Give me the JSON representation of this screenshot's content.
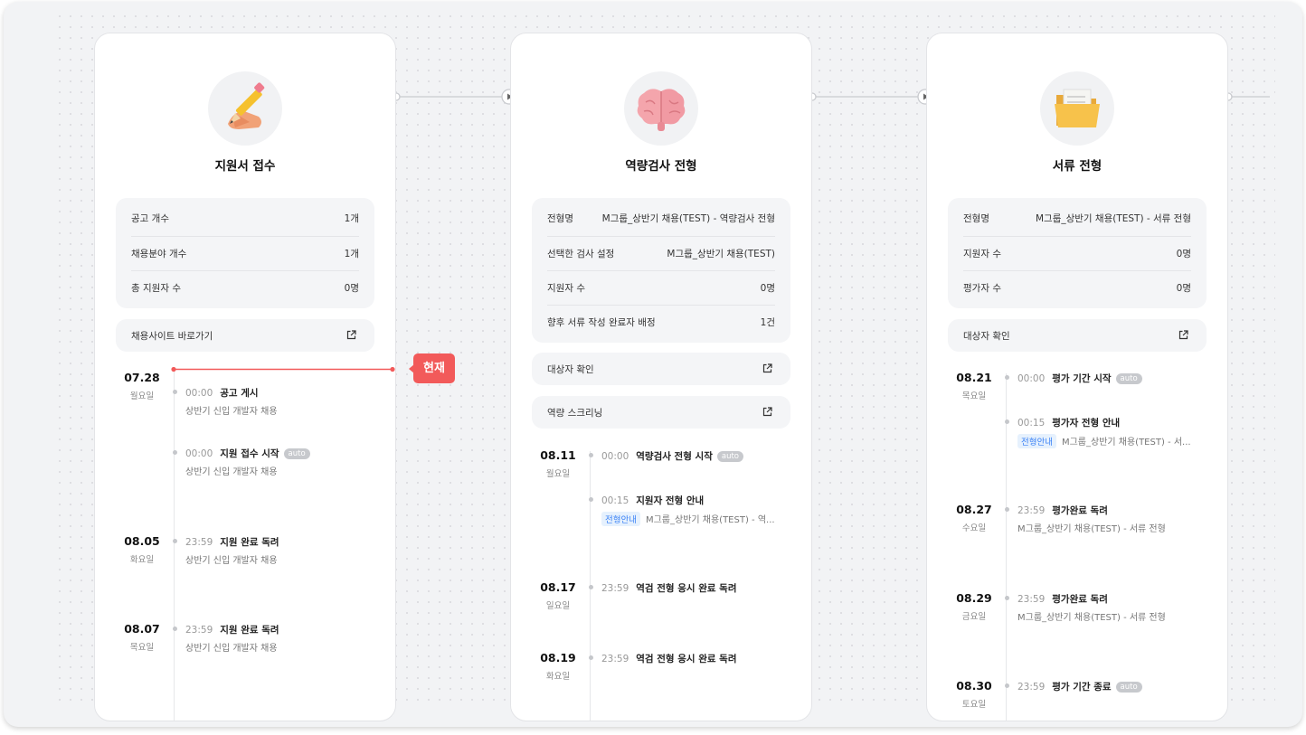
{
  "now_label": "현재",
  "stages": [
    {
      "title": "지원서 접수",
      "emoji_icon": "pencil-hand-icon",
      "info": [
        {
          "label": "공고 개수",
          "value": "1개"
        },
        {
          "label": "채용분야 개수",
          "value": "1개"
        },
        {
          "label": "총 지원자 수",
          "value": "0명"
        }
      ],
      "links": [
        "채용사이트 바로가기"
      ],
      "timeline": [
        {
          "date": "07.28",
          "weekday": "월요일",
          "events": [
            {
              "time": "00:00",
              "title": "공고 게시",
              "sub": "상반기 신입 개발자 채용"
            },
            {
              "time": "00:00",
              "title": "지원 접수 시작",
              "badge": "auto",
              "sub": "상반기 신입 개발자 채용"
            }
          ]
        },
        {
          "date": "08.05",
          "weekday": "화요일",
          "events": [
            {
              "time": "23:59",
              "title": "지원 완료 독려",
              "sub": "상반기 신입 개발자 채용"
            }
          ]
        },
        {
          "date": "08.07",
          "weekday": "목요일",
          "events": [
            {
              "time": "23:59",
              "title": "지원 완료 독려",
              "sub": "상반기 신입 개발자 채용"
            }
          ]
        }
      ]
    },
    {
      "title": "역량검사 전형",
      "emoji_icon": "brain-icon",
      "info": [
        {
          "label": "전형명",
          "value": "M그룹_상반기 채용(TEST) - 역량검사 전형"
        },
        {
          "label": "선택한 검사 설정",
          "value": "M그룹_상반기 채용(TEST)"
        },
        {
          "label": "지원자 수",
          "value": "0명"
        },
        {
          "label": "향후 서류 작성 완료자 배정",
          "value": "1건"
        }
      ],
      "links": [
        "대상자 확인",
        "역량 스크리닝"
      ],
      "timeline": [
        {
          "date": "08.11",
          "weekday": "월요일",
          "events": [
            {
              "time": "00:00",
              "title": "역량검사 전형 시작",
              "badge": "auto"
            },
            {
              "time": "00:15",
              "title": "지원자 전형 안내",
              "tag": "전형안내",
              "sub": "M그룹_상반기 채용(TEST) - 역..."
            }
          ]
        },
        {
          "date": "08.17",
          "weekday": "일요일",
          "events": [
            {
              "time": "23:59",
              "title": "역검 전형 응시 완료 독려"
            }
          ]
        },
        {
          "date": "08.19",
          "weekday": "화요일",
          "events": [
            {
              "time": "23:59",
              "title": "역검 전형 응시 완료 독려"
            }
          ]
        }
      ]
    },
    {
      "title": "서류 전형",
      "emoji_icon": "folder-icon",
      "info": [
        {
          "label": "전형명",
          "value": "M그룹_상반기 채용(TEST) - 서류 전형"
        },
        {
          "label": "지원자 수",
          "value": "0명"
        },
        {
          "label": "평가자 수",
          "value": "0명"
        }
      ],
      "links": [
        "대상자 확인"
      ],
      "timeline": [
        {
          "date": "08.21",
          "weekday": "목요일",
          "events": [
            {
              "time": "00:00",
              "title": "평가 기간 시작",
              "badge": "auto"
            },
            {
              "time": "00:15",
              "title": "평가자 전형 안내",
              "tag": "전형안내",
              "sub": "M그룹_상반기 채용(TEST) - 서..."
            }
          ]
        },
        {
          "date": "08.27",
          "weekday": "수요일",
          "events": [
            {
              "time": "23:59",
              "title": "평가완료 독려",
              "sub": "M그룹_상반기 채용(TEST) - 서류 전형"
            }
          ]
        },
        {
          "date": "08.29",
          "weekday": "금요일",
          "events": [
            {
              "time": "23:59",
              "title": "평가완료 독려",
              "sub": "M그룹_상반기 채용(TEST) - 서류 전형"
            }
          ]
        },
        {
          "date": "08.30",
          "weekday": "토요일",
          "events": [
            {
              "time": "23:59",
              "title": "평가 기간 종료",
              "badge": "auto"
            }
          ]
        }
      ]
    }
  ]
}
